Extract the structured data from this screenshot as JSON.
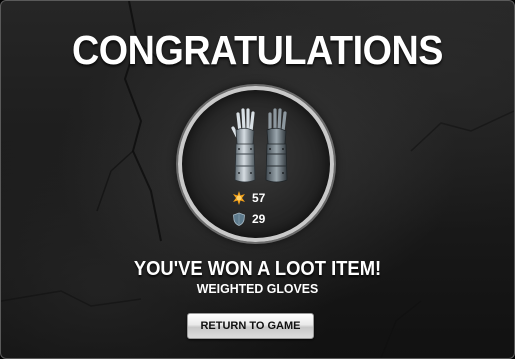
{
  "dialog": {
    "title": "CONGRATULATIONS",
    "headline": "YOU'VE WON A LOOT ITEM!",
    "item_name": "WEIGHTED GLOVES",
    "return_label": "RETURN TO GAME"
  },
  "item": {
    "icon": "gauntlets-icon",
    "stats": {
      "attack": {
        "icon": "attack-burst-icon",
        "value": "57"
      },
      "defense": {
        "icon": "shield-icon",
        "value": "29"
      }
    }
  },
  "colors": {
    "background": "#1a1a1a",
    "ring": "#c9c9c9",
    "text": "#ffffff",
    "attack": "#f5a21a",
    "defense": "#5d7a8c"
  }
}
